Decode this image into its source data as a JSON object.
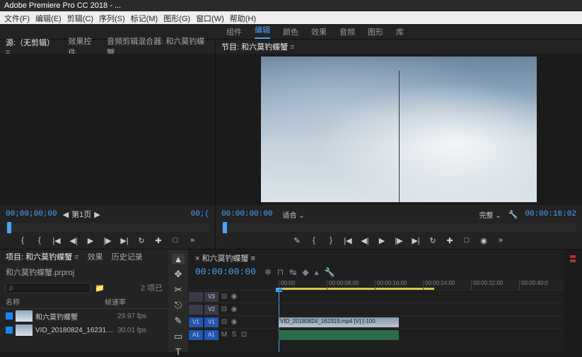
{
  "app_title": "Adobe Premiere Pro CC 2018 - ...",
  "menu": [
    "文件(F)",
    "编辑(E)",
    "剪辑(C)",
    "序列(S)",
    "标记(M)",
    "图形(G)",
    "窗口(W)",
    "帮助(H)"
  ],
  "workspace_tabs": [
    {
      "label": "组件",
      "active": false
    },
    {
      "label": "编辑",
      "active": true
    },
    {
      "label": "颜色",
      "active": false
    },
    {
      "label": "效果",
      "active": false
    },
    {
      "label": "音频",
      "active": false
    },
    {
      "label": "图形",
      "active": false
    },
    {
      "label": "库",
      "active": false
    }
  ],
  "source": {
    "tabs": [
      "源:（无剪辑）",
      "效果控件",
      "音频剪辑混合器: 和六莫钓蝶蟹"
    ],
    "active_tab": 0,
    "tc": "00;00;00;00",
    "pager_label": "第1页",
    "tc_out": "00;(",
    "controls": [
      "{",
      "{",
      "|◀",
      "◀|",
      "▶",
      "|▶",
      "▶|",
      "↻",
      "✚",
      "□",
      "»"
    ]
  },
  "program": {
    "tab": "节目: 和六莫钓蝶蟹",
    "tc_in": "00:00:00:00",
    "fit_label": "适合",
    "full_label": "完整",
    "tc_out": "00:00:16:02",
    "controls": [
      "✎",
      "{",
      "}",
      "|◀",
      "◀|",
      "▶",
      "|▶",
      "▶|",
      "↻",
      "✚",
      "□",
      "◉",
      "»"
    ]
  },
  "project": {
    "tabs": [
      "项目: 和六莫钓蝶蟹",
      "效果",
      "历史记录"
    ],
    "active_tab": 0,
    "file": "和六莫钓蝶蟹.prproj",
    "search_placeholder": "ρ",
    "count_label": "2 项已",
    "columns": [
      "名称",
      "帧速率"
    ],
    "items": [
      {
        "name": "和六莫钓蝶蟹",
        "rate": "29.97 fps"
      },
      {
        "name": "VID_20180824_162319.mp4",
        "rate": "30.01 fps"
      }
    ]
  },
  "tools": [
    "▲",
    "✥",
    "✂",
    "⎋",
    "✎",
    "▭",
    "T"
  ],
  "timeline": {
    "tab": "和六莫钓蝶蟹",
    "tc": "00:00:00:00",
    "icons": [
      "❄",
      "⊓",
      "↹",
      "◆",
      "▴",
      "🔧"
    ],
    "ticks": [
      "00:00",
      "00:00:08:00",
      "00:00:16:00",
      "00:00:24:00",
      "00:00:32:00",
      "00:00:40:0"
    ],
    "tracks": [
      {
        "src": "",
        "tgt": "V3",
        "label": "V3",
        "toggles": [
          "⊟",
          "◉"
        ]
      },
      {
        "src": "",
        "tgt": "V2",
        "label": "V2",
        "toggles": [
          "⊟",
          "◉"
        ]
      },
      {
        "src": "V1",
        "tgt": "V1",
        "label": "V1",
        "toggles": [
          "⊟",
          "◉"
        ],
        "hi": true
      },
      {
        "src": "A1",
        "tgt": "A1",
        "label": "A1",
        "toggles": [
          "M",
          "S",
          "⊡"
        ],
        "hi": true
      }
    ],
    "clip_label": "VID_20180824_162319.mp4 [V] [-100"
  }
}
